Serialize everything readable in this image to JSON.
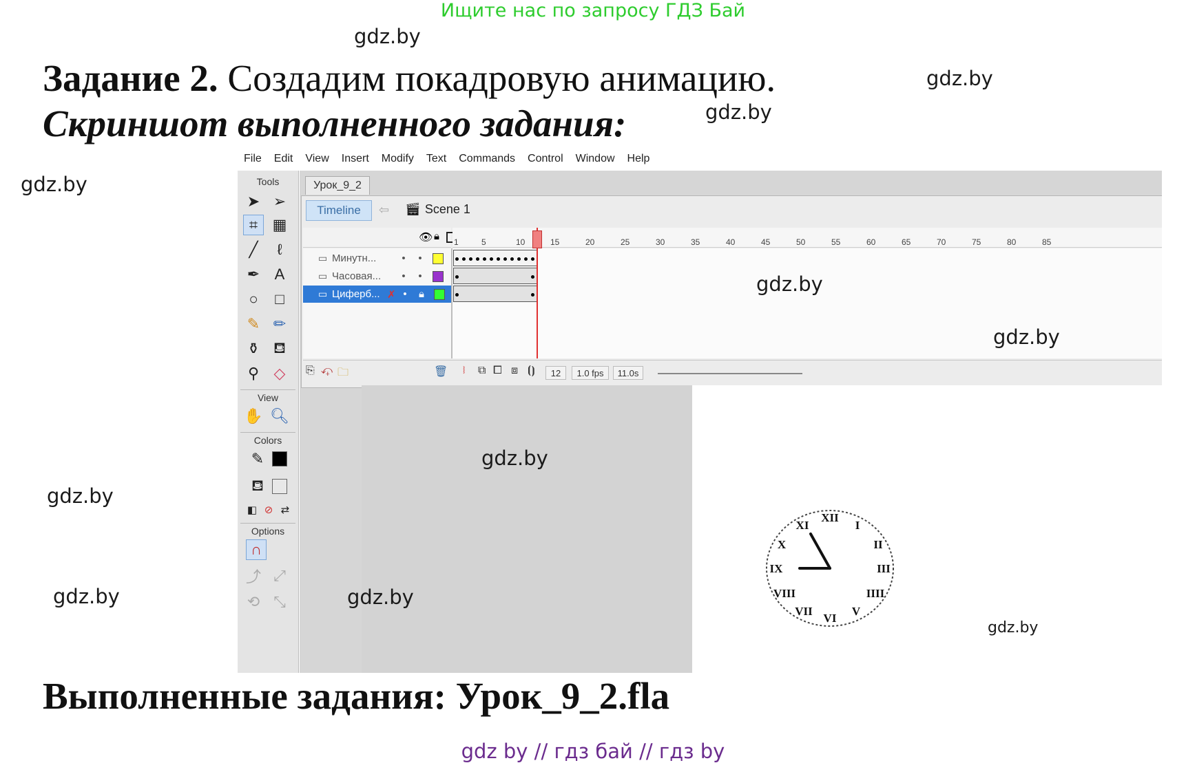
{
  "promo_top": "Ищите нас по запросу ГДЗ Бай",
  "promo_bottom": "gdz by  //  гдз бай  //  гдз by",
  "watermark": "gdz.by",
  "task": {
    "label": "Задание 2.",
    "text": "Создадим покадровую анимацию.",
    "screenshot_caption": "Скриншот выполненного задания:",
    "completed_files": "Выполненные задания: Урок_9_2.fla"
  },
  "app": {
    "menu": [
      "File",
      "Edit",
      "View",
      "Insert",
      "Modify",
      "Text",
      "Commands",
      "Control",
      "Window",
      "Help"
    ],
    "tools_title": "Tools",
    "view_title": "View",
    "colors_title": "Colors",
    "options_title": "Options",
    "document_tab": "Урок_9_2",
    "timeline_button": "Timeline",
    "scene_label": "Scene 1",
    "ruler_ticks": [
      "1",
      "5",
      "10",
      "15",
      "20",
      "25",
      "30",
      "35",
      "40",
      "45",
      "50",
      "55",
      "60",
      "65",
      "70",
      "75",
      "80",
      "85"
    ],
    "layers": [
      {
        "name": "Минутн...",
        "color": "#ffff33",
        "selected": false,
        "hidden": false
      },
      {
        "name": "Часовая...",
        "color": "#9933cc",
        "selected": false,
        "hidden": false
      },
      {
        "name": "Циферб...",
        "color": "#33ff33",
        "selected": true,
        "hidden": true
      }
    ],
    "footer": {
      "current_frame": "12",
      "frame_rate": "1.0 fps",
      "elapsed_time": "11.0s"
    },
    "clock_numerals": [
      "XII",
      "I",
      "II",
      "III",
      "IIII",
      "V",
      "VI",
      "VII",
      "VIII",
      "IX",
      "X",
      "XI"
    ]
  }
}
